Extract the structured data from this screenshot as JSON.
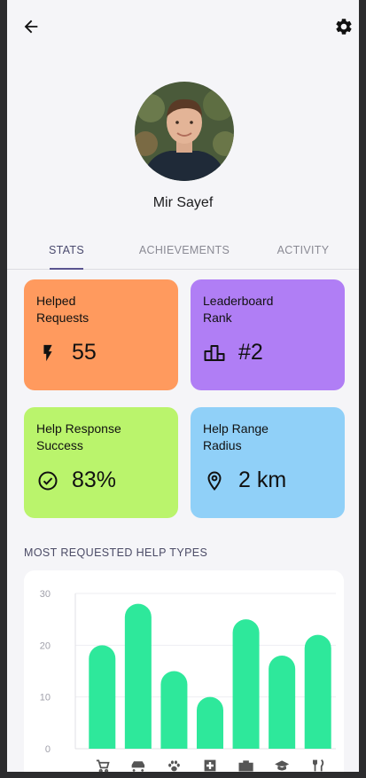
{
  "profile": {
    "name": "Mir Sayef"
  },
  "tabs": [
    {
      "label": "STATS",
      "active": true
    },
    {
      "label": "ACHIEVEMENTS",
      "active": false
    },
    {
      "label": "ACTIVITY",
      "active": false
    }
  ],
  "stats": [
    {
      "title_line1": "Helped",
      "title_line2": "Requests",
      "value": "55",
      "icon": "bolt-icon",
      "color": "#ff9a5e"
    },
    {
      "title_line1": "Leaderboard",
      "title_line2": "Rank",
      "value": "#2",
      "icon": "leaderboard-icon",
      "color": "#b07ef5"
    },
    {
      "title_line1": "Help Response",
      "title_line2": "Success",
      "value": "83%",
      "icon": "check-circle-icon",
      "color": "#baf46c"
    },
    {
      "title_line1": "Help Range",
      "title_line2": "Radius",
      "value": "2 km",
      "icon": "location-pin-icon",
      "color": "#90d0f8"
    }
  ],
  "section": {
    "title": "MOST REQUESTED HELP TYPES"
  },
  "chart_data": {
    "type": "bar",
    "categories": [
      "shopping-cart-icon",
      "car-icon",
      "paw-icon",
      "medical-icon",
      "toolbox-icon",
      "graduation-cap-icon",
      "restaurant-icon"
    ],
    "values": [
      20,
      28,
      15,
      10,
      25,
      18,
      22
    ],
    "ylim": [
      0,
      30
    ],
    "yticks": [
      "0",
      "10",
      "20",
      "30"
    ],
    "bar_color": "#2ee89b",
    "grid": true
  },
  "colors": {
    "background": "#f5f5f8",
    "accent": "#5a5490"
  }
}
